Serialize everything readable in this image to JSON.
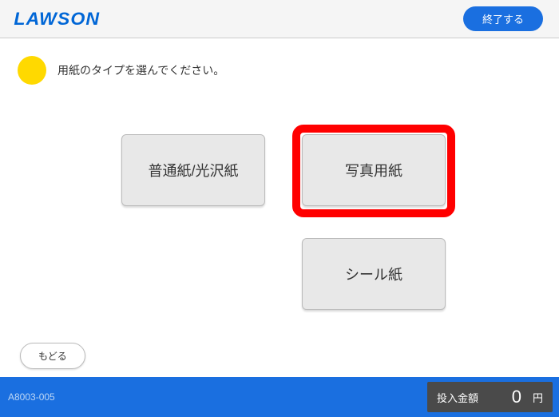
{
  "header": {
    "logo_text": "LAWSON",
    "end_button_label": "終了する"
  },
  "instruction": {
    "text": "用紙のタイプを選んでください。"
  },
  "options": {
    "plain_label": "普通紙/光沢紙",
    "photo_label": "写真用紙",
    "seal_label": "シール紙"
  },
  "back_button_label": "もどる",
  "footer": {
    "screen_code": "A8003-005",
    "amount_label": "投入金額",
    "amount_value": "0",
    "amount_unit": "円"
  }
}
